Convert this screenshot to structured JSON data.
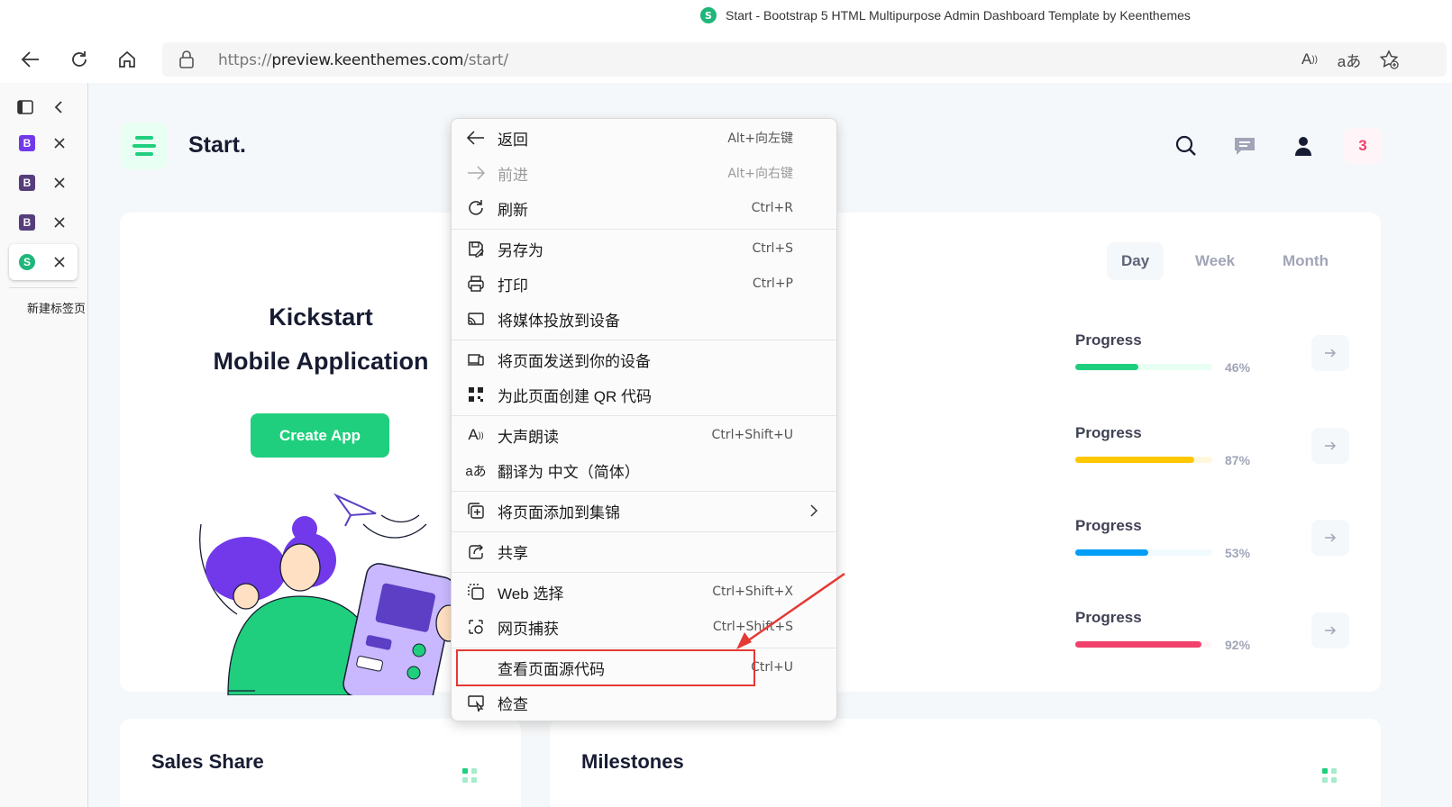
{
  "browser": {
    "tab_title": "Start - Bootstrap 5 HTML Multipurpose Admin Dashboard Template by Keenthemes",
    "favicon_letter": "S",
    "url_prefix": "https://",
    "url_host": "preview.keenthemes.com",
    "url_path": "/start/",
    "vertical_tabs": [
      {
        "icon_letter": "B",
        "color": "#7239ea"
      },
      {
        "icon_letter": "B",
        "color": "#563d7c"
      },
      {
        "icon_letter": "B",
        "color": "#563d7c"
      },
      {
        "icon_letter": "S",
        "color": "#1fb67a",
        "active": true
      }
    ],
    "new_tab_label": "新建标签页"
  },
  "page": {
    "brand": "Start.",
    "notification_count": "3",
    "hero": {
      "title_line1": "Kickstart",
      "title_line2": "Mobile Application",
      "create_button": "Create App"
    },
    "periods": [
      "Day",
      "Week",
      "Month"
    ],
    "active_period": "Day",
    "progress_items": [
      {
        "label": "Progress",
        "percent": 46,
        "percent_label": "46%",
        "color": "#1fcf7e",
        "track": "#e8fff3"
      },
      {
        "label": "Progress",
        "percent": 87,
        "percent_label": "87%",
        "color": "#ffc700",
        "track": "#fff8dd"
      },
      {
        "label": "Progress",
        "percent": 53,
        "percent_label": "53%",
        "color": "#009ef7",
        "track": "#f1faff"
      },
      {
        "label": "Progress",
        "percent": 92,
        "percent_label": "92%",
        "color": "#f1416c",
        "track": "#fff5f8"
      }
    ],
    "bottom_cards": [
      "Sales Share",
      "Milestones"
    ]
  },
  "context_menu": {
    "items": [
      {
        "label": "返回",
        "shortcut": "Alt+向左键",
        "icon": "back-arrow-icon"
      },
      {
        "label": "前进",
        "shortcut": "Alt+向右键",
        "icon": "forward-arrow-icon",
        "disabled": true
      },
      {
        "label": "刷新",
        "shortcut": "Ctrl+R",
        "icon": "refresh-icon"
      },
      {
        "label": "另存为",
        "shortcut": "Ctrl+S",
        "icon": "save-as-icon"
      },
      {
        "label": "打印",
        "shortcut": "Ctrl+P",
        "icon": "print-icon"
      },
      {
        "label": "将媒体投放到设备",
        "shortcut": "",
        "icon": "cast-icon"
      },
      {
        "label": "将页面发送到你的设备",
        "shortcut": "",
        "icon": "send-to-device-icon"
      },
      {
        "label": "为此页面创建 QR 代码",
        "shortcut": "",
        "icon": "qr-code-icon"
      },
      {
        "label": "大声朗读",
        "shortcut": "Ctrl+Shift+U",
        "icon": "read-aloud-icon"
      },
      {
        "label": "翻译为 中文（简体）",
        "shortcut": "",
        "icon": "translate-icon"
      },
      {
        "label": "将页面添加到集锦",
        "shortcut": "",
        "icon": "collections-icon"
      },
      {
        "label": "共享",
        "shortcut": "",
        "icon": "share-icon"
      },
      {
        "label": "Web 选择",
        "shortcut": "Ctrl+Shift+X",
        "icon": "web-select-icon"
      },
      {
        "label": "网页捕获",
        "shortcut": "Ctrl+Shift+S",
        "icon": "web-capture-icon"
      },
      {
        "label": "查看页面源代码",
        "shortcut": "Ctrl+U",
        "icon": "view-source-icon"
      },
      {
        "label": "检查",
        "shortcut": "",
        "icon": "inspect-icon"
      }
    ]
  },
  "annotation": {
    "highlight_color": "#e53935"
  }
}
